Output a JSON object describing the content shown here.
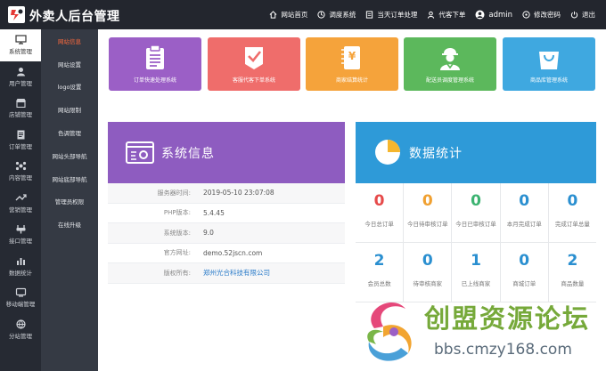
{
  "app": {
    "title": "外卖人后台管理"
  },
  "topnav": [
    {
      "label": "网站首页",
      "icon": "home-icon"
    },
    {
      "label": "调度系统",
      "icon": "dispatch-icon"
    },
    {
      "label": "当天订单处理",
      "icon": "order-icon"
    },
    {
      "label": "代客下单",
      "icon": "proxy-order-icon"
    },
    {
      "label": "admin",
      "icon": "user-icon"
    },
    {
      "label": "修改密码",
      "icon": "password-icon"
    },
    {
      "label": "退出",
      "icon": "logout-icon"
    }
  ],
  "sidebar": [
    {
      "label": "系统管理",
      "icon": "monitor-icon",
      "active": true
    },
    {
      "label": "用户管理",
      "icon": "users-icon"
    },
    {
      "label": "店铺管理",
      "icon": "shop-icon"
    },
    {
      "label": "订单管理",
      "icon": "order-doc-icon"
    },
    {
      "label": "内容管理",
      "icon": "content-icon"
    },
    {
      "label": "营销管理",
      "icon": "marketing-icon"
    },
    {
      "label": "接口管理",
      "icon": "api-icon"
    },
    {
      "label": "数据统计",
      "icon": "chart-icon"
    },
    {
      "label": "移动端管理",
      "icon": "mobile-icon"
    },
    {
      "label": "分站管理",
      "icon": "branch-icon"
    }
  ],
  "subnav": [
    {
      "label": "网站信息",
      "active": true
    },
    {
      "label": "网站设置"
    },
    {
      "label": "logo设置"
    },
    {
      "label": "网站限制"
    },
    {
      "label": "色调管理"
    },
    {
      "label": "网站头部导航"
    },
    {
      "label": "网站底部导航"
    },
    {
      "label": "管理员权限"
    },
    {
      "label": "在线升级"
    }
  ],
  "cards": [
    {
      "label": "订单快速处理系统",
      "color": "#9b5fc6",
      "icon": "clipboard-icon"
    },
    {
      "label": "客服代客下单系统",
      "color": "#ef6d6b",
      "icon": "check-doc-icon"
    },
    {
      "label": "商家结算统计",
      "color": "#f5a33b",
      "icon": "invoice-icon"
    },
    {
      "label": "配送员调度管理系统",
      "color": "#5cb85c",
      "icon": "courier-icon"
    },
    {
      "label": "商品库管理系统",
      "color": "#3fa8e0",
      "icon": "shopping-bag-icon"
    }
  ],
  "sysinfo": {
    "title": "系统信息",
    "color": "#8e5cc0",
    "rows": [
      {
        "key": "服务器时间:",
        "value": "2019-05-10 23:07:08"
      },
      {
        "key": "PHP版本:",
        "value": "5.4.45"
      },
      {
        "key": "系统版本:",
        "value": "9.0"
      },
      {
        "key": "官方网址:",
        "value": "demo.52jscn.com"
      },
      {
        "key": "版权所有:",
        "value": "郑州光合科技有限公司"
      }
    ]
  },
  "stats": {
    "title": "数据统计",
    "color": "#2e9ad8",
    "rows": [
      [
        {
          "value": "0",
          "label": "今日总订单",
          "color": "#e64a4a"
        },
        {
          "value": "0",
          "label": "今日待审核订单",
          "color": "#f0a030"
        },
        {
          "value": "0",
          "label": "今日已审核订单",
          "color": "#3cb371"
        },
        {
          "value": "0",
          "label": "本月完成订单",
          "color": "#2a8fd0"
        },
        {
          "value": "0",
          "label": "完成订单总量",
          "color": "#2a8fd0"
        }
      ],
      [
        {
          "value": "2",
          "label": "会员总数",
          "color": "#2a8fd0"
        },
        {
          "value": "0",
          "label": "待审核商家",
          "color": "#2a8fd0"
        },
        {
          "value": "1",
          "label": "已上线商家",
          "color": "#2a8fd0"
        },
        {
          "value": "0",
          "label": "商城订单",
          "color": "#2a8fd0"
        },
        {
          "value": "2",
          "label": "商品数量",
          "color": "#2a8fd0"
        }
      ]
    ]
  },
  "watermark": {
    "text": "创盟资源论坛",
    "url": "bbs.cmzy168.com"
  }
}
